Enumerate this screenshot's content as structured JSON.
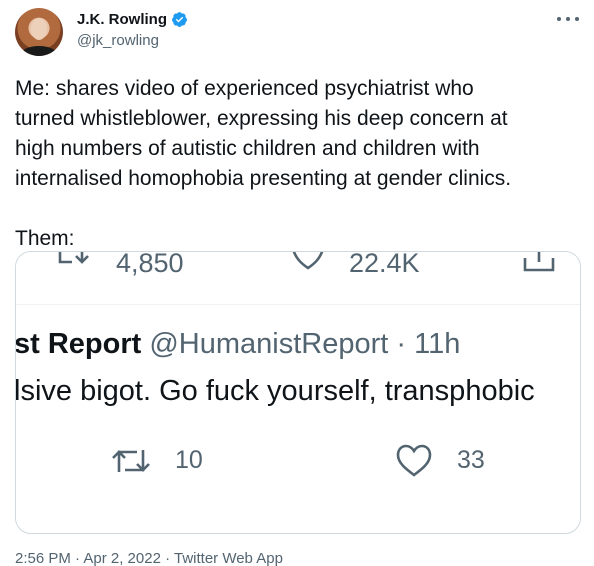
{
  "author": {
    "name": "J.K. Rowling",
    "handle": "@jk_rowling",
    "verified": true
  },
  "tweet": {
    "lines": [
      "Me: shares video of experienced psychiatrist who",
      "turned whistleblower, expressing his deep concern at",
      "high numbers of autistic children and children with",
      "internalised homophobia presenting at gender clinics."
    ],
    "them_label": "Them:"
  },
  "embedded": {
    "top_retweets": "4,850",
    "top_likes": "22.4K",
    "author_fragment": "st Report",
    "handle_and_time": "@HumanistReport · 11h",
    "text_fragment": "lsive bigot. Go fuck yourself, transphobic",
    "retweets": "10",
    "likes": "33"
  },
  "footer": {
    "timestamp": "2:56 PM · Apr 2, 2022 · Twitter Web App"
  },
  "colors": {
    "text": "#0f1419",
    "secondary": "#536471",
    "verified_blue": "#1d9bf0",
    "border": "#cfd9de"
  },
  "icons": [
    "verified-badge-icon",
    "more-options-icon",
    "retweet-icon",
    "heart-icon",
    "share-icon"
  ]
}
